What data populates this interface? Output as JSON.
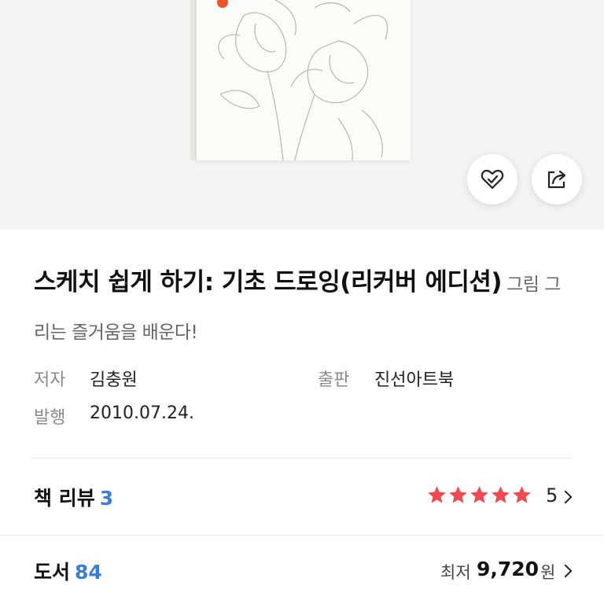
{
  "book": {
    "title": "스케치 쉽게 하기: 기초 드로잉(리커버 에디션)",
    "subtitle": "그림 그리는 즐거움을 배운다!"
  },
  "meta": {
    "author_label": "저자",
    "author": "김충원",
    "publisher_label": "출판",
    "publisher": "진선아트북",
    "date_label": "발행",
    "date": "2010.07.24."
  },
  "reviews": {
    "label": "책 리뷰",
    "count": "3",
    "rating": "5",
    "star_count": 5,
    "star_color": "#ef4a52"
  },
  "listing": {
    "label": "도서",
    "count": "84",
    "price_label": "최저",
    "price": "9,720",
    "price_unit": "원"
  },
  "actions": {
    "like_icon": "heart-check-icon",
    "share_icon": "share-icon"
  },
  "colors": {
    "accent": "#3c7bd6",
    "hero_bg": "#f4f4f5"
  }
}
